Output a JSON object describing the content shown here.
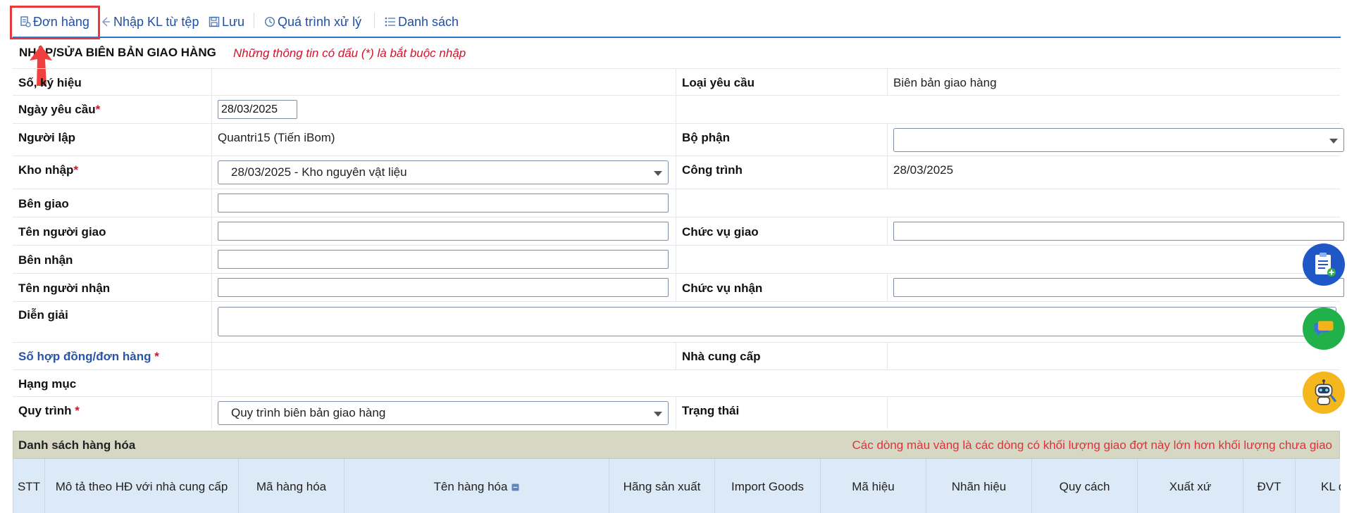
{
  "toolbar": {
    "items": [
      {
        "label": "Đơn hàng",
        "icon": "order-icon"
      },
      {
        "label": "Nhập KL từ tệp",
        "icon": "import-icon"
      },
      {
        "label": "Lưu",
        "icon": "save-icon"
      },
      {
        "label": "Quá trình xử lý",
        "icon": "history-icon"
      },
      {
        "label": "Danh sách",
        "icon": "list-icon"
      }
    ]
  },
  "form": {
    "title": "NHẬP/SỬA BIÊN BẢN GIAO HÀNG",
    "note": "Những thông tin có dấu (*) là bắt buộc nhập",
    "so_ky_hieu_label": "Số, ký hiệu",
    "loai_yeu_cau_label": "Loại yêu cầu",
    "loai_yeu_cau_value": "Biên bản giao hàng",
    "ngay_yeu_cau_label": "Ngày yêu cầu",
    "ngay_yeu_cau_value": "28/03/2025",
    "nguoi_lap_label": "Người lập",
    "nguoi_lap_value": "Quantri15 (Tiến iBom)",
    "bo_phan_label": "Bộ phận",
    "bo_phan_value": "",
    "kho_nhap_label": "Kho nhập",
    "kho_nhap_value": "28/03/2025 - Kho nguyên vật liệu",
    "cong_trinh_label": "Công trình",
    "cong_trinh_value": "28/03/2025",
    "ben_giao_label": "Bên giao",
    "ben_giao_value": "",
    "ten_nguoi_giao_label": "Tên người giao",
    "ten_nguoi_giao_value": "",
    "chuc_vu_giao_label": "Chức vụ giao",
    "chuc_vu_giao_value": "",
    "ben_nhan_label": "Bên nhận",
    "ben_nhan_value": "",
    "ten_nguoi_nhan_label": "Tên người nhận",
    "ten_nguoi_nhan_value": "",
    "chuc_vu_nhan_label": "Chức vụ nhận",
    "chuc_vu_nhan_value": "",
    "dien_giai_label": "Diễn giải",
    "dien_giai_value": "",
    "so_hop_dong_label": "Số hợp đồng/đơn hàng",
    "nha_cung_cap_label": "Nhà cung cấp",
    "hang_muc_label": "Hạng mục",
    "quy_trinh_label": "Quy trình",
    "quy_trinh_value": "Quy trình biên bản giao hàng",
    "trang_thai_label": "Trạng thái",
    "required_mark": "*"
  },
  "goods": {
    "title": "Danh sách hàng hóa",
    "note": "Các dòng màu vàng là các dòng có khối lượng giao đợt này lớn hơn khối lượng chưa giao",
    "columns": [
      "STT",
      "Mô tả theo HĐ với nhà cung cấp",
      "Mã hàng hóa",
      "Tên hàng hóa",
      "Hãng sản xuất",
      "Import Goods",
      "Mã hiệu",
      "Nhãn hiệu",
      "Quy cách",
      "Xuất xứ",
      "ĐVT",
      "KL đặt N("
    ]
  },
  "colors": {
    "accent": "#2b74c7",
    "required": "#d0142c",
    "highlight_box": "#e53b3b",
    "goods_header_bg": "#d7d8c3",
    "table_header_bg": "#dce9f7"
  }
}
